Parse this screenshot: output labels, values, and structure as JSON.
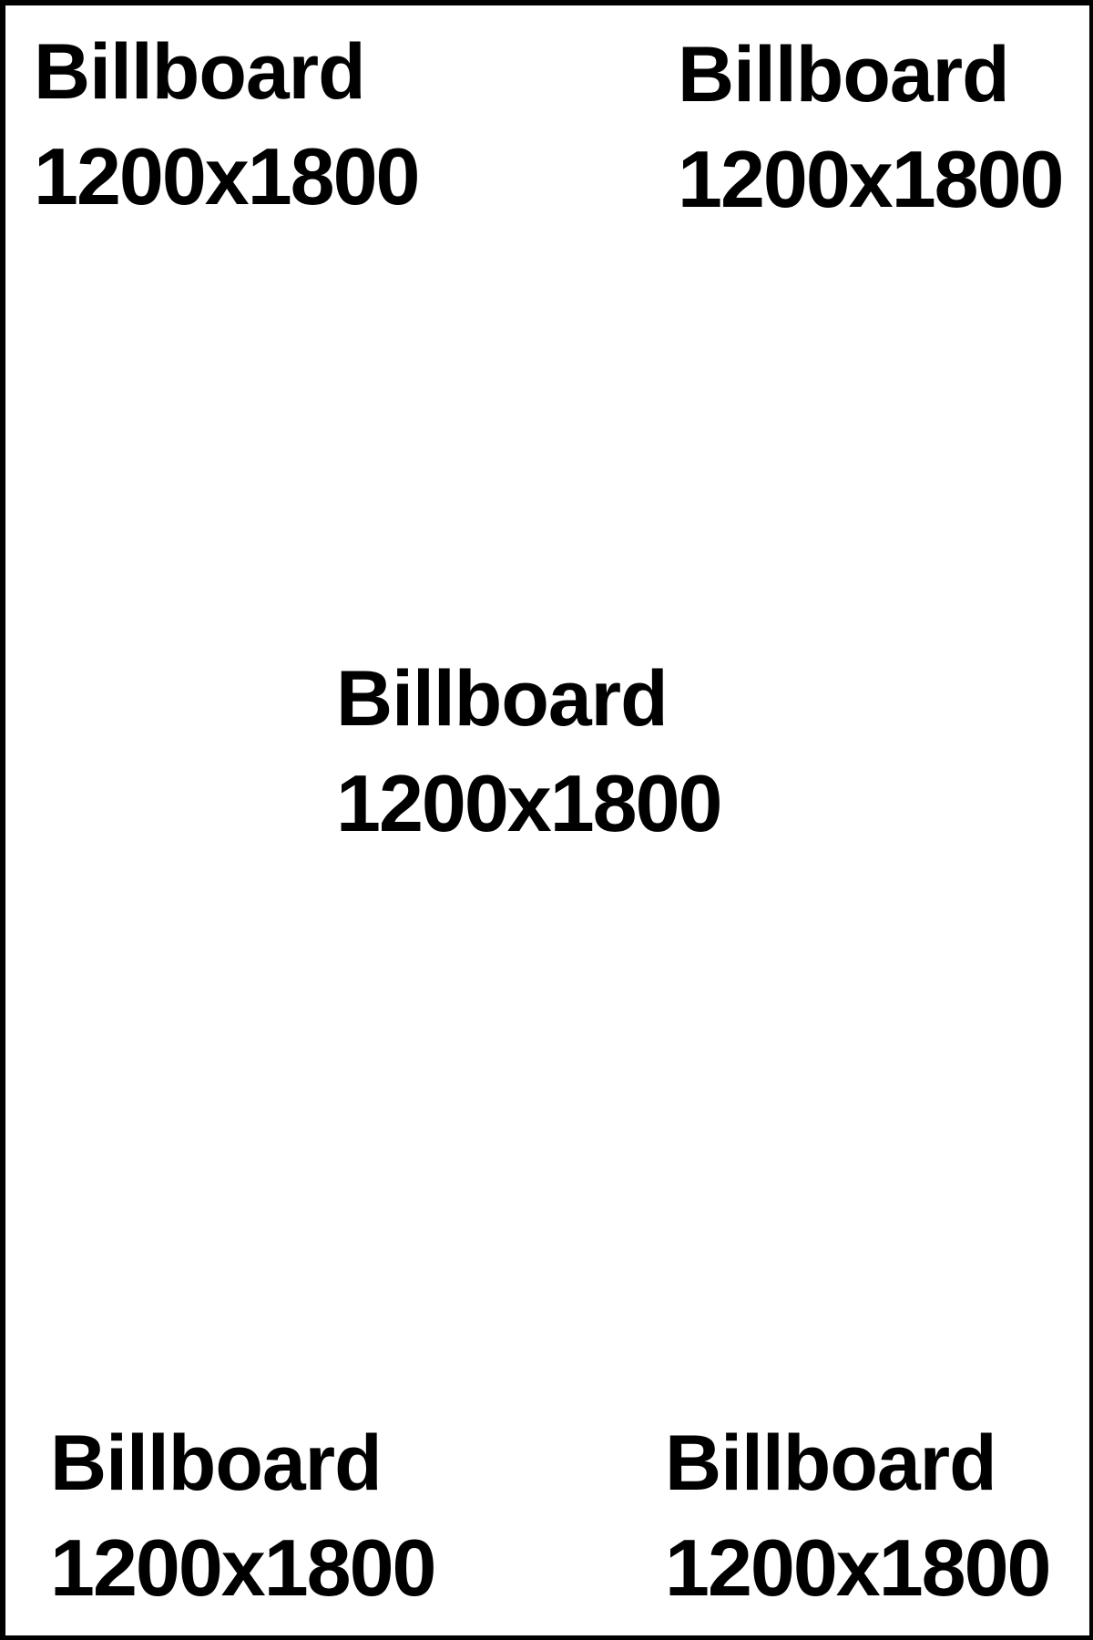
{
  "page": {
    "border_color": "#000000",
    "background_color": "#ffffff",
    "text_color": "#000000"
  },
  "labels": [
    {
      "title": "Billboard",
      "size": "1200x1800"
    },
    {
      "title": "Billboard",
      "size": "1200x1800"
    },
    {
      "title": "Billboard",
      "size": "1200x1800"
    },
    {
      "title": "Billboard",
      "size": "1200x1800"
    },
    {
      "title": "Billboard",
      "size": "1200x1800"
    }
  ]
}
